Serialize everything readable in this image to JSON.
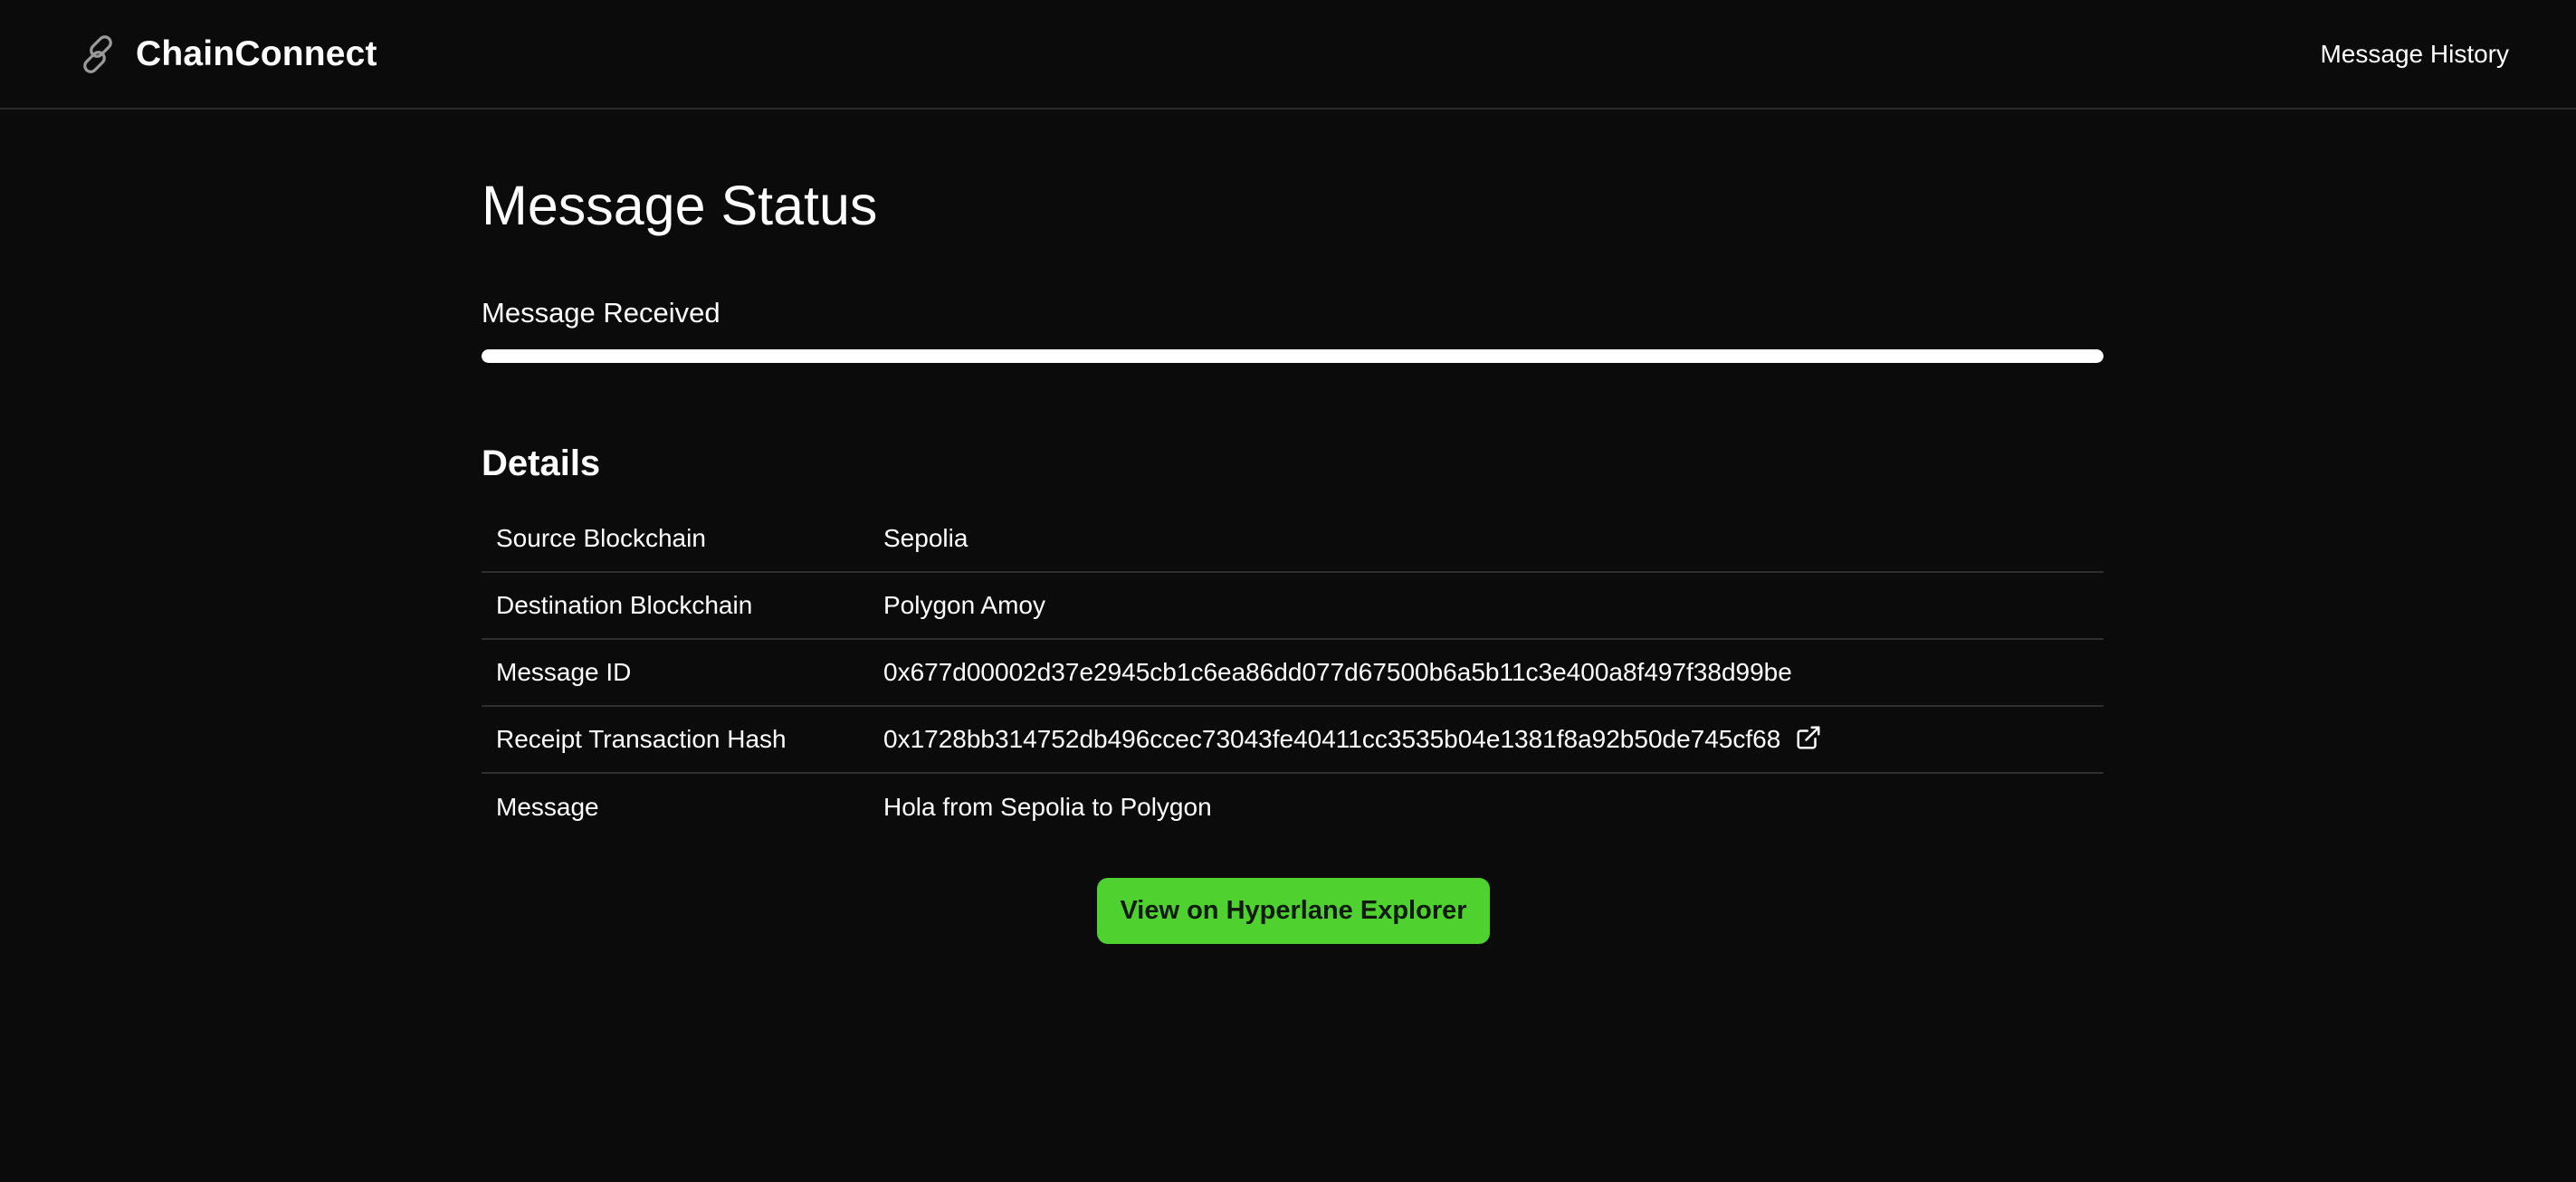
{
  "header": {
    "brand": "ChainConnect",
    "logo_icon": "chain-link-icon",
    "nav": {
      "message_history": "Message History"
    }
  },
  "main": {
    "title": "Message Status",
    "status": {
      "label": "Message Received",
      "progress_percent": 100
    },
    "details": {
      "title": "Details",
      "rows": [
        {
          "label": "Source Blockchain",
          "value": "Sepolia"
        },
        {
          "label": "Destination Blockchain",
          "value": "Polygon Amoy"
        },
        {
          "label": "Message ID",
          "value": "0x677d00002d37e2945cb1c6ea86dd077d67500b6a5b11c3e400a8f497f38d99be"
        },
        {
          "label": "Receipt Transaction Hash",
          "value": "0x1728bb314752db496ccec73043fe40411cc3535b04e1381f8a92b50de745cf68",
          "icon": "external-link-icon"
        },
        {
          "label": "Message",
          "value": "Hola from Sepolia to Polygon"
        }
      ]
    },
    "explorer_button": "View on Hyperlane Explorer"
  },
  "colors": {
    "background": "#0b0b0b",
    "text": "#ffffff",
    "accent": "#4fd12f",
    "divider": "#2e2e2e"
  }
}
